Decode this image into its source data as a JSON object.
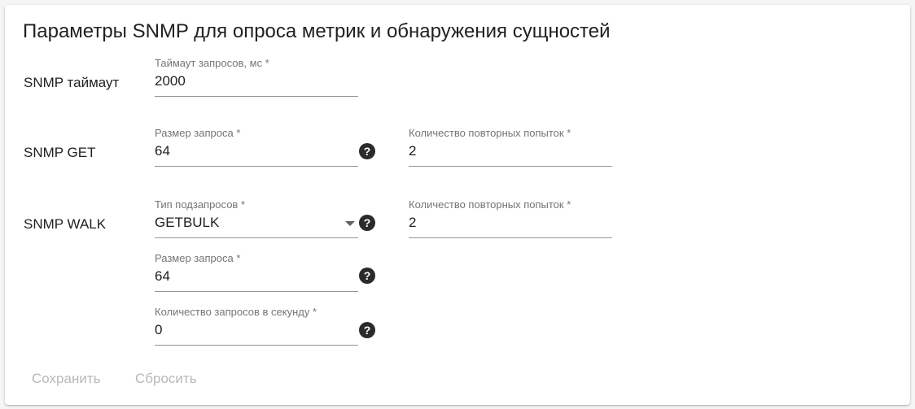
{
  "page": {
    "title": "Параметры SNMP для опроса метрик и обнаружения сущностей"
  },
  "timeout": {
    "row_label": "SNMP таймаут",
    "field": {
      "label": "Таймаут запросов, мс *",
      "value": "2000"
    }
  },
  "get": {
    "row_label": "SNMP GET",
    "request_size": {
      "label": "Размер запроса *",
      "value": "64"
    },
    "retries": {
      "label": "Количество повторных попыток *",
      "value": "2"
    }
  },
  "walk": {
    "row_label": "SNMP WALK",
    "subrequest_type": {
      "label": "Тип подзапросов *",
      "value": "GETBULK"
    },
    "retries": {
      "label": "Количество повторных попыток *",
      "value": "2"
    },
    "request_size": {
      "label": "Размер запроса *",
      "value": "64"
    },
    "requests_per_second": {
      "label": "Количество запросов в секунду *",
      "value": "0"
    }
  },
  "icons": {
    "help": "?",
    "help_name": "help-circle-icon",
    "dropdown_name": "chevron-down-icon"
  },
  "actions": {
    "save": "Сохранить",
    "reset": "Сбросить"
  },
  "colors": {
    "disabled_text": "#b8b8b8",
    "label_text": "#757575",
    "underline": "#949494"
  }
}
